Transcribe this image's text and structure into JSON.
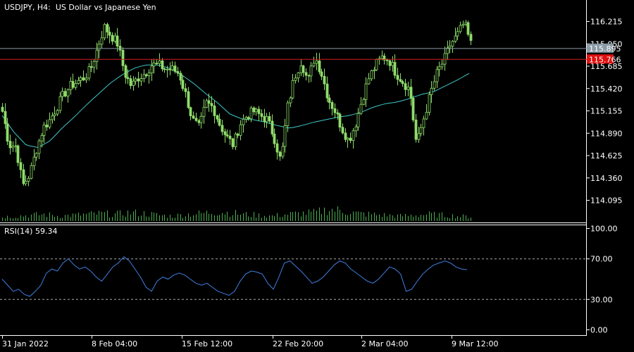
{
  "main_title": "USDJPY, H4:  US Dollar vs Japanese Yen",
  "rsi_title": "RSI(14) 59.34",
  "colors": {
    "background": "#000000",
    "bull_candle": "#8fdc6a",
    "bear_candle": "#8fdc6a",
    "moving_average": "#3fc8c8",
    "volume": "#4caf50",
    "rsi_line": "#3f7fe0",
    "bid_line": "#8a9aa6",
    "ask_line": "#d02020",
    "ask_tag": "#e01010",
    "level_line": "#aaaaaa"
  },
  "chart_data": [
    {
      "type": "candlestick",
      "symbol": "USDJPY",
      "timeframe": "H4",
      "title": "USDJPY, H4:  US Dollar vs Japanese Yen",
      "y_ticks": [
        "116.215",
        "115.950",
        "115.685",
        "115.420",
        "115.155",
        "114.890",
        "114.625",
        "114.360",
        "114.095"
      ],
      "ylim": [
        113.96,
        116.36
      ],
      "x_ticks": [
        "31 Jan 2022",
        "8 Feb 04:00",
        "15 Feb 12:00",
        "22 Feb 20:00",
        "2 Mar 04:00",
        "9 Mar 12:00"
      ],
      "bid_price": "115.895",
      "ask_price": "115.766",
      "closes_anchor": [
        115.15,
        114.75,
        114.74,
        114.27,
        114.4,
        114.7,
        114.95,
        115.05,
        115.2,
        115.35,
        115.45,
        115.5,
        115.55,
        115.65,
        115.9,
        116.15,
        116.05,
        115.95,
        115.6,
        115.45,
        115.55,
        115.6,
        115.7,
        115.7,
        115.65,
        115.65,
        115.6,
        115.35,
        115.05,
        114.95,
        115.25,
        115.2,
        115.0,
        114.85,
        114.75,
        115.0,
        115.1,
        115.15,
        115.1,
        115.05,
        114.85,
        114.55,
        115.2,
        115.55,
        115.75,
        115.5,
        115.8,
        115.6,
        115.3,
        115.15,
        114.95,
        114.8,
        115.0,
        115.3,
        115.55,
        115.7,
        115.8,
        115.75,
        115.6,
        115.5,
        115.4,
        114.75,
        115.05,
        115.35,
        115.6,
        115.75,
        115.95,
        116.05,
        116.2,
        115.95
      ],
      "ma_anchor": [
        115.1,
        114.9,
        114.75,
        114.72,
        114.8,
        114.95,
        115.08,
        115.22,
        115.35,
        115.48,
        115.58,
        115.66,
        115.7,
        115.7,
        115.66,
        115.58,
        115.48,
        115.36,
        115.25,
        115.12,
        115.06,
        115.05,
        115.02,
        114.98,
        114.95,
        114.98,
        115.02,
        115.05,
        115.08,
        115.1,
        115.14,
        115.2,
        115.24,
        115.26,
        115.3,
        115.35,
        115.38,
        115.45,
        115.52,
        115.6
      ],
      "volume_anchor": [
        5,
        6,
        7,
        8,
        6,
        7,
        8,
        9,
        8,
        10,
        9,
        7,
        6,
        8,
        9,
        11,
        10,
        8,
        7,
        6,
        8,
        9,
        10,
        14,
        12,
        9,
        8,
        7,
        6,
        7,
        8,
        7,
        6,
        5
      ]
    },
    {
      "type": "line",
      "title": "RSI(14) 59.34",
      "indicator": "RSI(14)",
      "last_value": 59.34,
      "y_ticks": [
        "100.00",
        "70.00",
        "30.00",
        "0.00"
      ],
      "ylim": [
        0,
        100
      ],
      "levels": [
        70,
        30
      ],
      "values": [
        50,
        44,
        38,
        40,
        35,
        33,
        38,
        44,
        56,
        60,
        58,
        66,
        70,
        64,
        60,
        62,
        58,
        52,
        48,
        55,
        62,
        66,
        72,
        68,
        60,
        52,
        42,
        38,
        48,
        52,
        50,
        54,
        56,
        54,
        50,
        46,
        44,
        46,
        42,
        38,
        36,
        34,
        38,
        48,
        55,
        58,
        57,
        55,
        46,
        40,
        52,
        66,
        68,
        63,
        58,
        52,
        46,
        48,
        52,
        58,
        64,
        68,
        66,
        60,
        56,
        52,
        48,
        46,
        50,
        56,
        62,
        60,
        55,
        38,
        40,
        48,
        55,
        60,
        64,
        66,
        68,
        66,
        62,
        60,
        59.34
      ]
    }
  ]
}
